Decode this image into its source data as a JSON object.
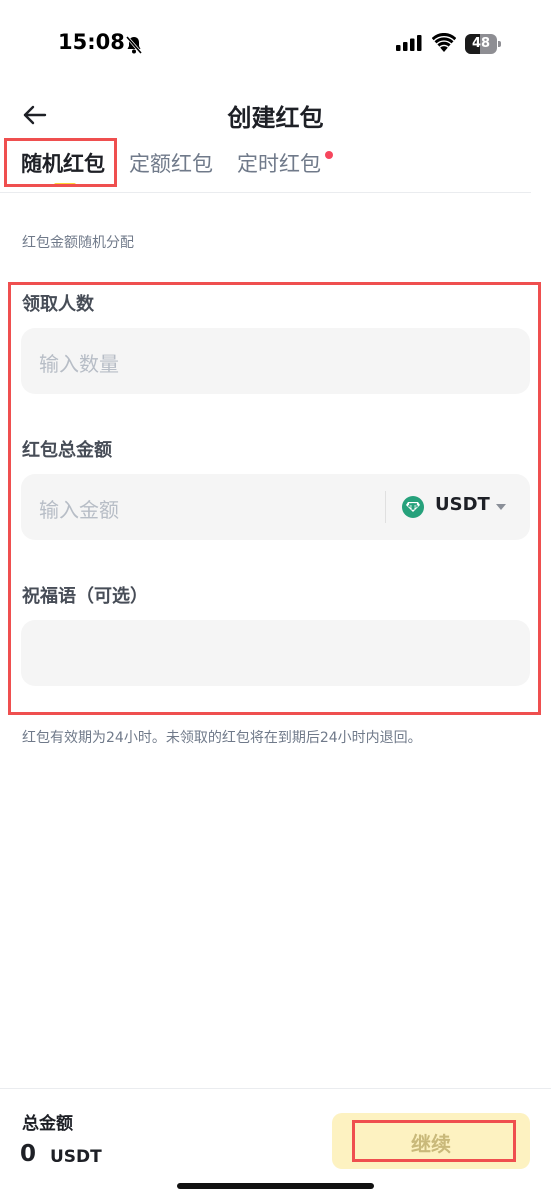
{
  "status_bar": {
    "time": "15:08",
    "battery": "48",
    "battery_level_pct": 48,
    "icons": [
      "bell-muted-icon",
      "signal-icon",
      "wifi-icon",
      "battery-icon"
    ]
  },
  "header": {
    "title": "创建红包",
    "back_icon": "arrow-left-icon"
  },
  "tabs": [
    {
      "label": "随机红包",
      "active": true
    },
    {
      "label": "定额红包",
      "active": false
    },
    {
      "label": "定时红包",
      "active": false,
      "has_dot": true
    }
  ],
  "description": "红包金额随机分配",
  "form": {
    "recipients": {
      "label": "领取人数",
      "placeholder": "输入数量",
      "value": ""
    },
    "amount": {
      "label": "红包总金额",
      "placeholder": "输入金额",
      "value": "",
      "currency": "USDT",
      "currency_icon": "tether-coin-icon"
    },
    "message": {
      "label": "祝福语（可选）",
      "placeholder": "",
      "value": ""
    }
  },
  "note": "红包有效期为24小时。未领取的红包将在到期后24小时内退回。",
  "footer": {
    "total_label": "总金额",
    "total_value": "0",
    "total_unit": "USDT",
    "continue_label": "继续"
  },
  "colors": {
    "accent": "#fcd535",
    "button_disabled_bg": "#fdf2c1",
    "highlight_box": "#ef4f4f",
    "notification_dot": "#f6465d",
    "usdt": "#26a17b"
  }
}
